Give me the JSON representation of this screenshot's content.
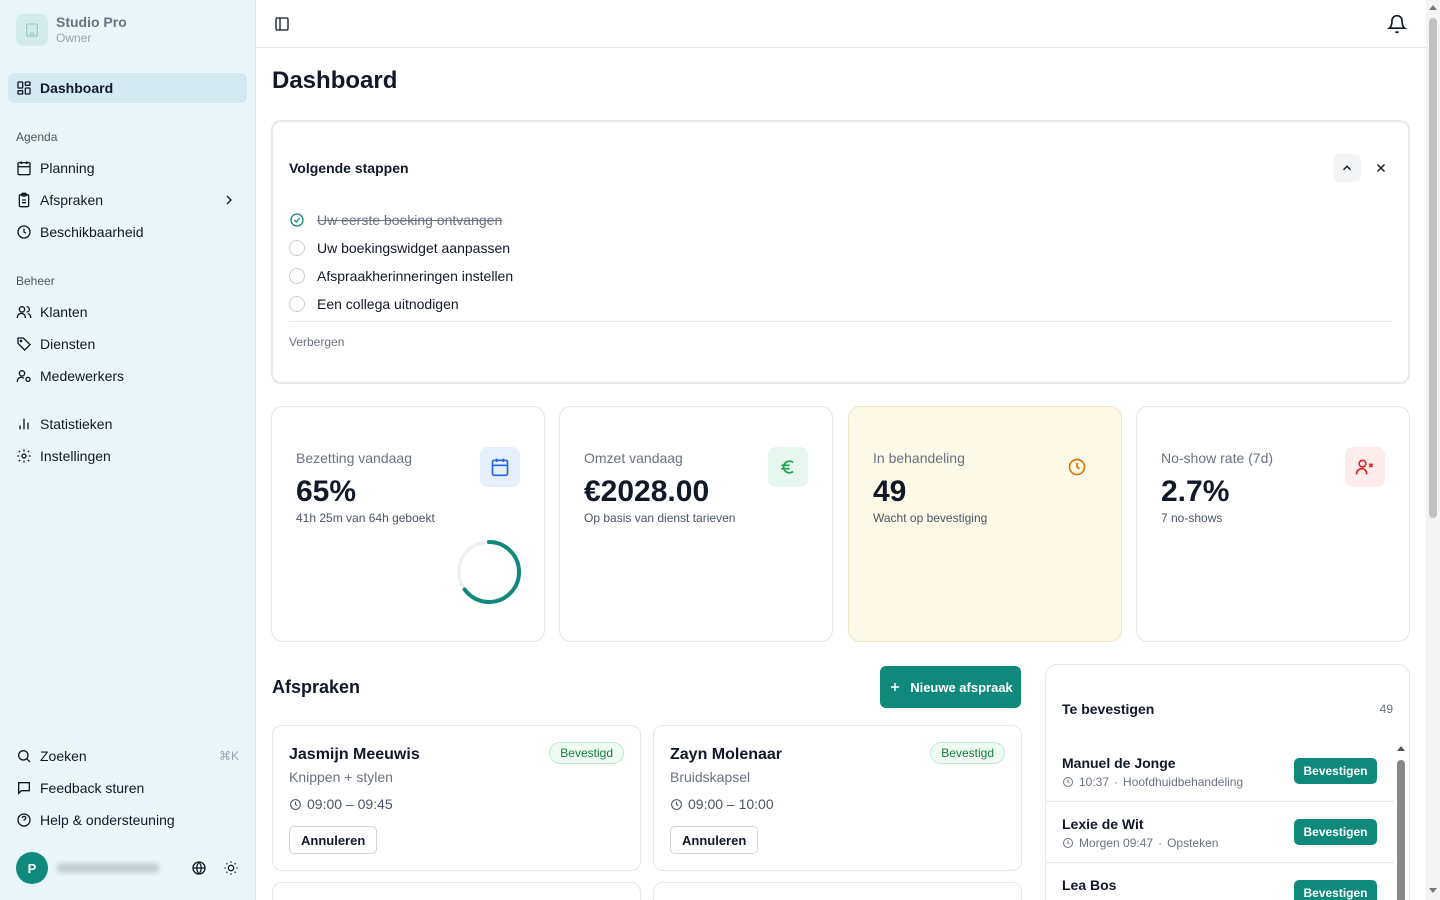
{
  "brand": {
    "name": "Studio Pro",
    "role": "Owner"
  },
  "sidebar": {
    "dashboard": "Dashboard",
    "agenda_label": "Agenda",
    "agenda": [
      "Planning",
      "Afspraken",
      "Beschikbaarheid"
    ],
    "beheer_label": "Beheer",
    "beheer": [
      "Klanten",
      "Diensten",
      "Medewerkers"
    ],
    "other": [
      "Statistieken",
      "Instellingen"
    ],
    "footer": [
      "Zoeken",
      "Feedback sturen",
      "Help & ondersteuning"
    ],
    "search_shortcut": "⌘K",
    "avatar_initial": "P"
  },
  "page": {
    "title": "Dashboard"
  },
  "steps": {
    "title": "Volgende stappen",
    "items": [
      {
        "label": "Uw eerste boeking ontvangen",
        "done": true
      },
      {
        "label": "Uw boekingswidget aanpassen",
        "done": false
      },
      {
        "label": "Afspraakherinneringen instellen",
        "done": false
      },
      {
        "label": "Een collega uitnodigen",
        "done": false
      }
    ],
    "hide_label": "Verbergen"
  },
  "stats": [
    {
      "label": "Bezetting vandaag",
      "value": "65%",
      "sub": "41h 25m van 64h geboekt",
      "icon": "calendar-icon",
      "progress": 0.65
    },
    {
      "label": "Omzet vandaag",
      "value": "€2028.00",
      "sub": "Op basis van dienst tarieven",
      "icon": "euro-icon"
    },
    {
      "label": "In behandeling",
      "value": "49",
      "sub": "Wacht op bevestiging",
      "icon": "clock-icon"
    },
    {
      "label": "No-show rate (7d)",
      "value": "2.7%",
      "sub": "7 no-shows",
      "icon": "user-x-icon"
    }
  ],
  "appointments": {
    "title": "Afspraken",
    "new_button": "Nieuwe afspraak",
    "items": [
      {
        "name": "Jasmijn Meeuwis",
        "service": "Knippen + stylen",
        "time": "09:00 – 09:45",
        "status": "Bevestigd",
        "action": "Annuleren"
      },
      {
        "name": "Zayn Molenaar",
        "service": "Bruidskapsel",
        "time": "09:00 – 10:00",
        "status": "Bevestigd",
        "action": "Annuleren"
      }
    ]
  },
  "to_confirm": {
    "title": "Te bevestigen",
    "count": "49",
    "button": "Bevestigen",
    "items": [
      {
        "name": "Manuel de Jonge",
        "time": "10:37",
        "service": "Hoofdhuidbehandeling"
      },
      {
        "name": "Lexie de Wit",
        "time": "Morgen 09:47",
        "service": "Opsteken"
      },
      {
        "name": "Lea Bos",
        "time": "",
        "service": ""
      }
    ]
  },
  "colors": {
    "accent": "#0f8a7a",
    "sidebar_bg": "#eaf6fa",
    "pending_bg": "#fdf9e8"
  }
}
